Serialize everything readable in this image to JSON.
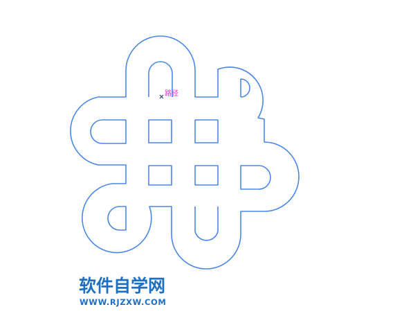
{
  "drawing": {
    "path_tooltip": "路径",
    "stroke_color": "#4a86e8",
    "tooltip_color": "#e02fe0",
    "anchor_icon": "anchor-cross-icon"
  },
  "watermark": {
    "title": "软件自学网",
    "url": "WWW.RJZXW.COM",
    "color": "#1e6fc0"
  }
}
